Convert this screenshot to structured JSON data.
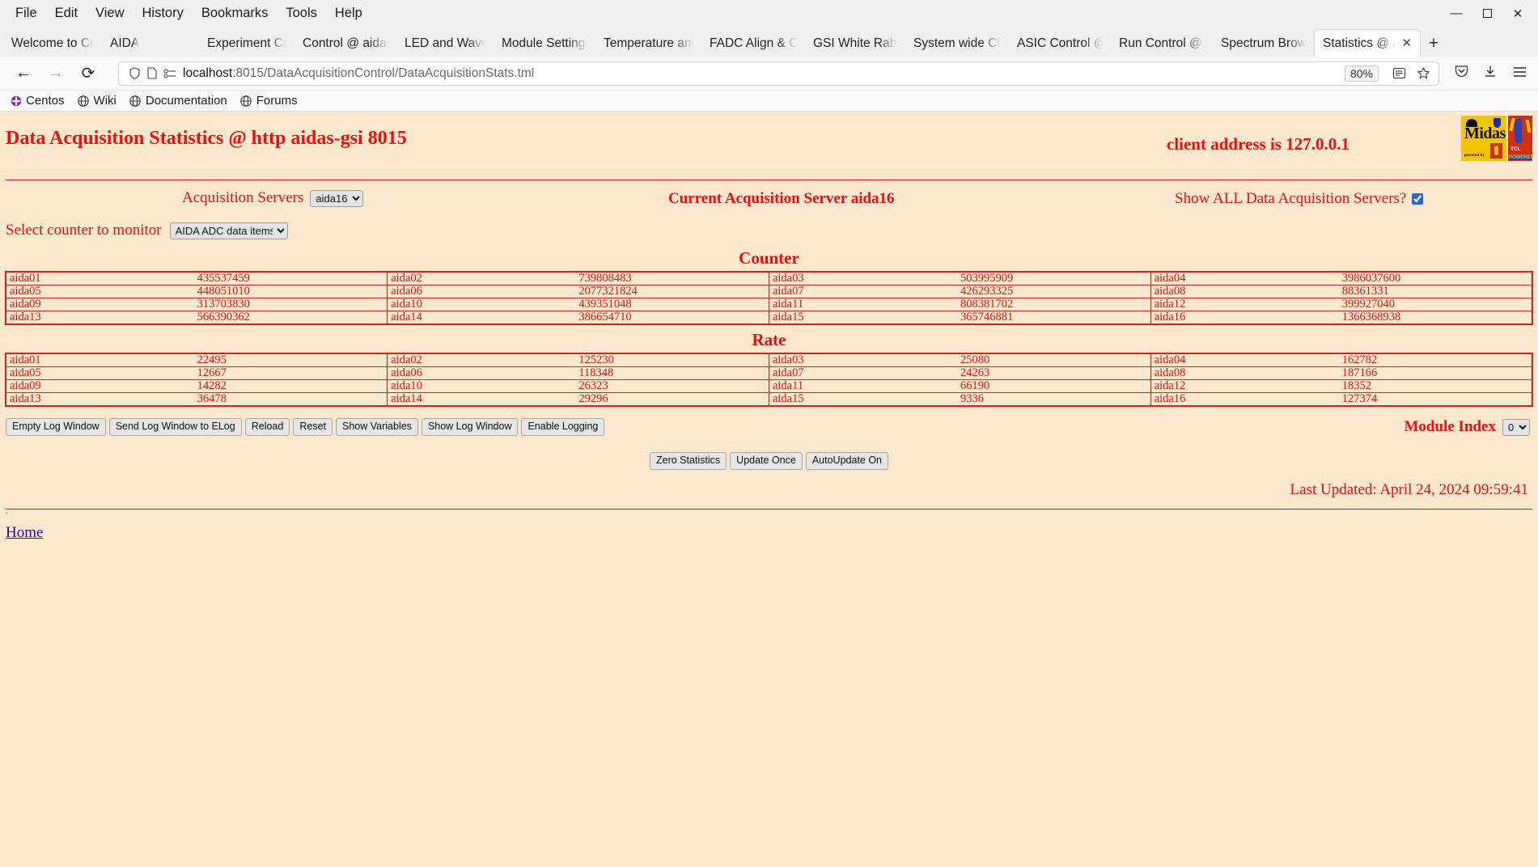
{
  "browser": {
    "menu": [
      "File",
      "Edit",
      "View",
      "History",
      "Bookmarks",
      "Tools",
      "Help"
    ],
    "window_controls": {
      "minimize": "—",
      "maximize": "⬜",
      "close": "✕"
    },
    "tabs": [
      {
        "label": "Welcome to CentOS",
        "active": false
      },
      {
        "label": "AIDA",
        "active": false
      },
      {
        "label": "Experiment Control",
        "active": false
      },
      {
        "label": "Control @ aidas-gsi",
        "active": false
      },
      {
        "label": "LED and Waveform",
        "active": false
      },
      {
        "label": "Module Settings St",
        "active": false
      },
      {
        "label": "Temperature and Vo",
        "active": false
      },
      {
        "label": "FADC Align & Con",
        "active": false
      },
      {
        "label": "GSI White Rabbit",
        "active": false
      },
      {
        "label": "System wide Check",
        "active": false
      },
      {
        "label": "ASIC Control @ aid",
        "active": false
      },
      {
        "label": "Run Control @ aida",
        "active": false
      },
      {
        "label": "Spectrum Browser",
        "active": false
      },
      {
        "label": "Statistics @ aidas",
        "active": true
      }
    ],
    "new_tab_label": "+",
    "close_tab_label": "✕",
    "nav": {
      "back": "←",
      "forward": "→",
      "reload": "⟳"
    },
    "url": {
      "host": "localhost",
      "path": ":8015/DataAcquisitionControl/DataAcquisitionStats.tml"
    },
    "zoom_level": "80%",
    "bookmarks": [
      {
        "label": "Centos",
        "icon": "centos-icon"
      },
      {
        "label": "Wiki",
        "icon": "globe-icon"
      },
      {
        "label": "Documentation",
        "icon": "globe-icon"
      },
      {
        "label": "Forums",
        "icon": "globe-icon"
      }
    ]
  },
  "page": {
    "title": "Data Acquisition Statistics @ http aidas-gsi 8015",
    "client_address": "client address is 127.0.0.1",
    "acquisition_servers_label": "Acquisition Servers",
    "acquisition_servers_value": "aida16",
    "current_server_label": "Current Acquisition Server aida16",
    "show_all_label": "Show ALL Data Acquisition Servers?",
    "show_all_checked": true,
    "select_counter_label": "Select counter to monitor",
    "select_counter_value": "AIDA ADC data items",
    "counter_section_title": "Counter",
    "rate_section_title": "Rate",
    "module_index_label": "Module Index",
    "module_index_value": "0",
    "last_updated": "Last Updated: April 24, 2024 09:59:41",
    "home_link": "Home",
    "logos": {
      "midas_word": "Midas",
      "midas_sub": "powered by",
      "tcl_text": "TCL",
      "tcl_powered": "POWERED"
    },
    "toolbar_buttons": [
      "Empty Log Window",
      "Send Log Window to ELog",
      "Reload",
      "Reset",
      "Show Variables",
      "Show Log Window",
      "Enable Logging"
    ],
    "center_buttons": [
      "Zero Statistics",
      "Update Once",
      "AutoUpdate On"
    ],
    "counter_rows": [
      [
        {
          "name": "aida01",
          "value": "435537459"
        },
        {
          "name": "aida02",
          "value": "739808483"
        },
        {
          "name": "aida03",
          "value": "503995909"
        },
        {
          "name": "aida04",
          "value": "3986037600"
        }
      ],
      [
        {
          "name": "aida05",
          "value": "448051010"
        },
        {
          "name": "aida06",
          "value": "2077321824"
        },
        {
          "name": "aida07",
          "value": "426293325"
        },
        {
          "name": "aida08",
          "value": "88361331"
        }
      ],
      [
        {
          "name": "aida09",
          "value": "313703830"
        },
        {
          "name": "aida10",
          "value": "439351048"
        },
        {
          "name": "aida11",
          "value": "808381702"
        },
        {
          "name": "aida12",
          "value": "399927040"
        }
      ],
      [
        {
          "name": "aida13",
          "value": "566390362"
        },
        {
          "name": "aida14",
          "value": "386654710"
        },
        {
          "name": "aida15",
          "value": "365746881"
        },
        {
          "name": "aida16",
          "value": "1366368938"
        }
      ]
    ],
    "rate_rows": [
      [
        {
          "name": "aida01",
          "value": "22495"
        },
        {
          "name": "aida02",
          "value": "125230"
        },
        {
          "name": "aida03",
          "value": "25080"
        },
        {
          "name": "aida04",
          "value": "162782"
        }
      ],
      [
        {
          "name": "aida05",
          "value": "12667"
        },
        {
          "name": "aida06",
          "value": "118348"
        },
        {
          "name": "aida07",
          "value": "24263"
        },
        {
          "name": "aida08",
          "value": "187166"
        }
      ],
      [
        {
          "name": "aida09",
          "value": "14282"
        },
        {
          "name": "aida10",
          "value": "26323"
        },
        {
          "name": "aida11",
          "value": "66190"
        },
        {
          "name": "aida12",
          "value": "18352"
        }
      ],
      [
        {
          "name": "aida13",
          "value": "36478"
        },
        {
          "name": "aida14",
          "value": "29296"
        },
        {
          "name": "aida15",
          "value": "9336"
        },
        {
          "name": "aida16",
          "value": "127374"
        }
      ]
    ]
  },
  "colors": {
    "page_bg": "#fce8cd",
    "accent_red": "#f20d0d",
    "table_border": "#d81e1e",
    "link_blue": "#2200cc"
  }
}
